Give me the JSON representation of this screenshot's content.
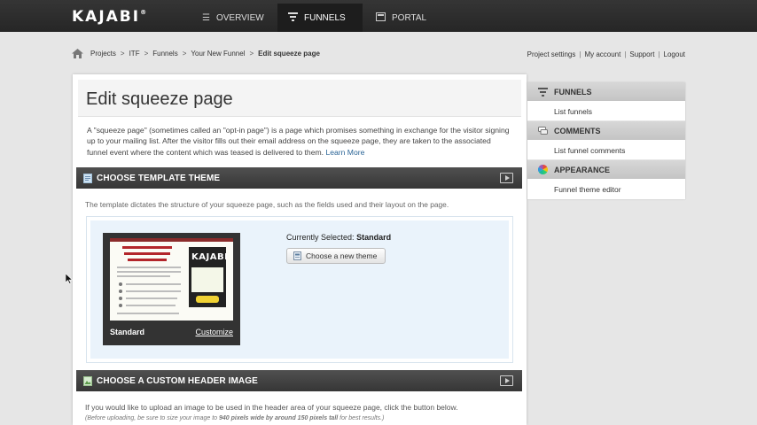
{
  "nav": {
    "logo": "KAJABI",
    "logo_mark": "®",
    "tabs": [
      {
        "label": "OVERVIEW",
        "icon": "list-icon"
      },
      {
        "label": "FUNNELS",
        "icon": "funnel-icon",
        "active": true
      },
      {
        "label": "PORTAL",
        "icon": "portal-icon"
      }
    ]
  },
  "breadcrumb": {
    "items": [
      "Projects",
      "ITF",
      "Funnels",
      "Your New Funnel"
    ],
    "separator": ">",
    "current": "Edit squeeze page"
  },
  "account_links": [
    "Project settings",
    "My account",
    "Support",
    "Logout"
  ],
  "account_separator": "|",
  "page": {
    "title": "Edit squeeze page",
    "intro": "A \"squeeze page\" (sometimes called an \"opt-in page\") is a page which promises something in exchange for the visitor signing up to your mailing list. After the visitor fills out their email address on the squeeze page, they are taken to the associated funnel event where the content which was teased is delivered to them.",
    "learn_more": "Learn More"
  },
  "template_section": {
    "title": "CHOOSE TEMPLATE THEME",
    "description": "The template dictates the structure of your squeeze page, such as the fields used and their layout on the page.",
    "preview_logo": "KAJABI",
    "preview_name": "Standard",
    "customize_label": "Customize",
    "selected_label": "Currently Selected:",
    "selected_value": "Standard",
    "choose_button": "Choose a new theme"
  },
  "header_section": {
    "title": "CHOOSE A CUSTOM HEADER IMAGE",
    "description": "If you would like to upload an image to be used in the header area of your squeeze page, click the button below.",
    "note_prefix": "(Before uploading, be sure to size your image to",
    "note_bold": "940 pixels wide by around 150 pixels tall",
    "note_suffix": "for best results.)"
  },
  "sidebar": {
    "sections": [
      {
        "title": "FUNNELS",
        "icon": "funnel-icon",
        "links": [
          "List funnels"
        ]
      },
      {
        "title": "COMMENTS",
        "icon": "comments-icon",
        "links": [
          "List funnel comments"
        ]
      },
      {
        "title": "APPEARANCE",
        "icon": "color-wheel-icon",
        "links": [
          "Funnel theme editor"
        ]
      }
    ]
  },
  "colors": {
    "topbar": "#2e2e2e",
    "section_header": "#434343",
    "link": "#2a6496",
    "theme_area": "#eaf3fb"
  }
}
